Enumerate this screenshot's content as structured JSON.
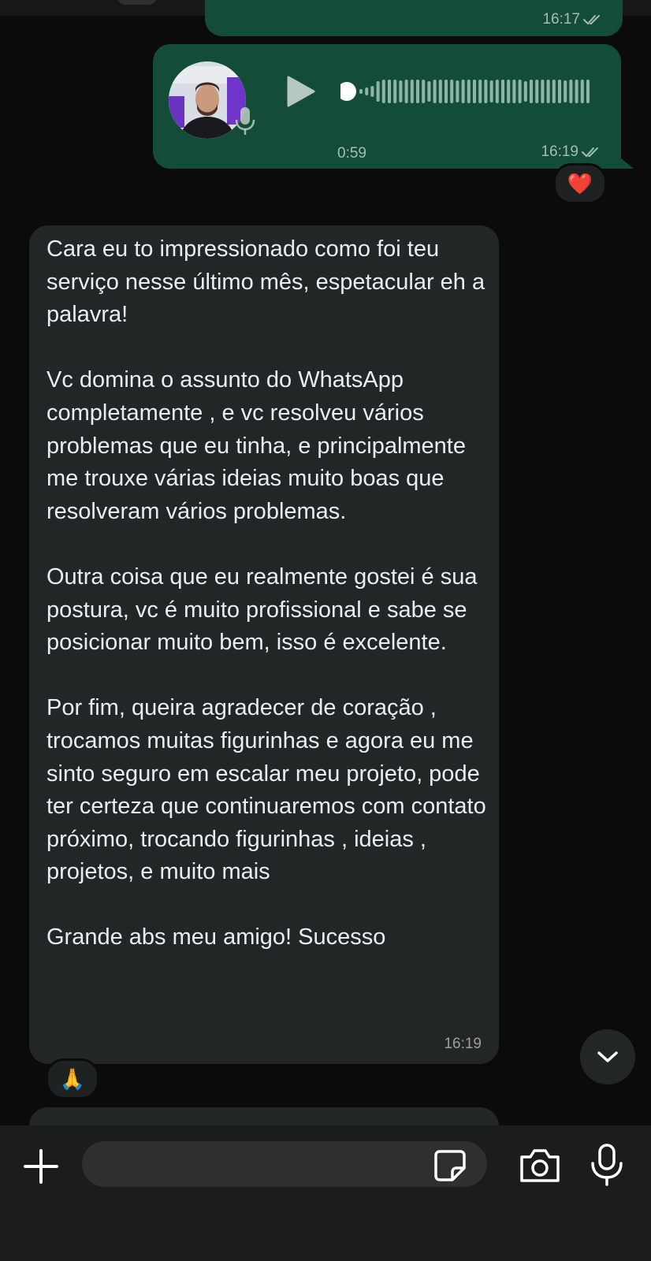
{
  "chat": {
    "prev_outgoing": {
      "time": "16:17"
    },
    "voice_message": {
      "duration": "0:59",
      "time": "16:19",
      "reaction": "❤️"
    },
    "incoming": {
      "text": "Cara eu to impressionado como foi teu serviço nesse último mês, espetacular eh a palavra!\n\nVc domina o assunto do WhatsApp completamente , e vc resolveu vários problemas que eu tinha, e principalmente me trouxe várias ideias muito boas que resolveram vários problemas.\n\nOutra coisa que eu realmente gostei é sua postura, vc é muito profissional e sabe se posicionar muito bem, isso é excelente.\n\nPor fim, queira agradecer de coração , trocamos muitas figurinhas e agora eu me sinto seguro em escalar meu projeto, pode ter certeza que continuaremos com contato próximo, trocando figurinhas , ideias , projetos, e muito mais\n\nGrande abs meu amigo! Sucesso",
      "time": "16:19",
      "reaction": "🙏"
    }
  },
  "composer": {
    "placeholder": ""
  },
  "colors": {
    "outgoing_bubble": "#144d37",
    "incoming_bubble": "#232627",
    "background": "#0b0b0b",
    "accent_green": "#21c063"
  },
  "icons": [
    "double-check-icon",
    "play-icon",
    "mic-icon",
    "chevron-down-icon",
    "plus-icon",
    "sticker-icon",
    "camera-icon"
  ]
}
